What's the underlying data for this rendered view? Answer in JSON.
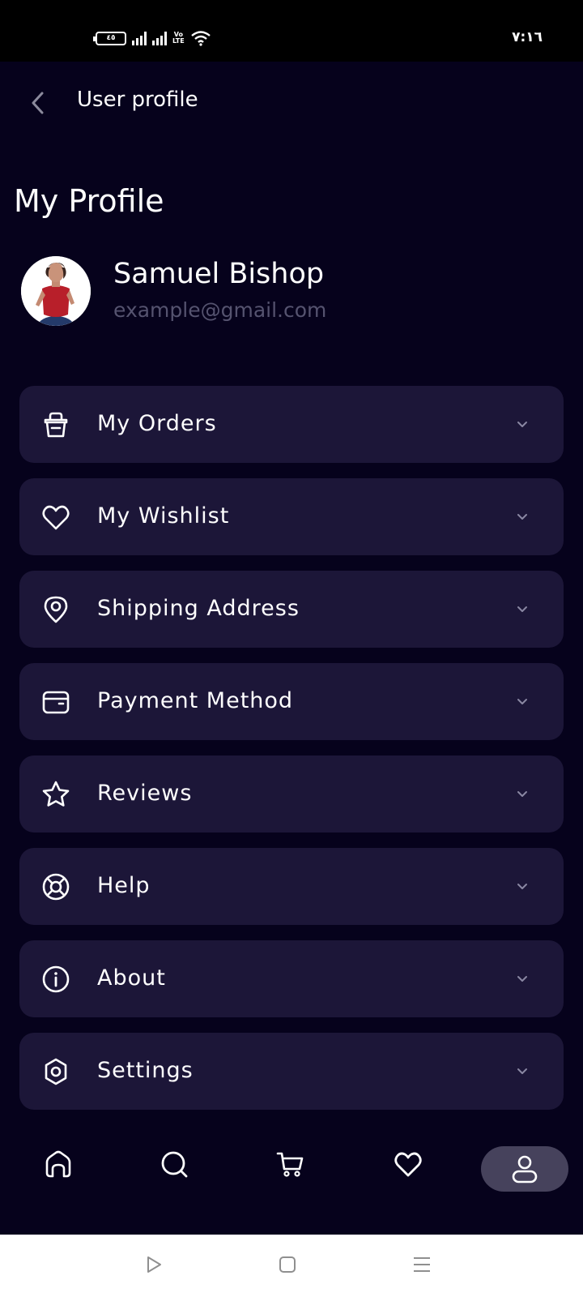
{
  "status_bar": {
    "battery_label": "٤٥",
    "network_label": "Vo\nLTE",
    "time": "٧:١٦"
  },
  "header": {
    "title": "User profile",
    "back_icon": "chevron-left-icon"
  },
  "page_title": "My Profile",
  "profile": {
    "name": "Samuel Bishop",
    "email": "example@gmail.com"
  },
  "menu": {
    "items": [
      {
        "label": "My Orders",
        "icon": "shopping-bag-icon"
      },
      {
        "label": "My Wishlist",
        "icon": "heart-icon"
      },
      {
        "label": "Shipping Address",
        "icon": "map-pin-icon"
      },
      {
        "label": "Payment Method",
        "icon": "wallet-icon"
      },
      {
        "label": "Reviews",
        "icon": "star-icon"
      },
      {
        "label": "Help",
        "icon": "lifebuoy-icon"
      },
      {
        "label": "About",
        "icon": "info-icon"
      },
      {
        "label": "Settings",
        "icon": "settings-gear-icon"
      }
    ]
  },
  "bottom_nav": {
    "items": [
      "home-icon",
      "search-icon",
      "cart-icon",
      "heart-icon",
      "user-icon"
    ],
    "active": "user-icon"
  },
  "colors": {
    "background": "#06021c",
    "card": "#1c1638",
    "muted_text": "#55536f",
    "active_nav": "#46425c"
  }
}
